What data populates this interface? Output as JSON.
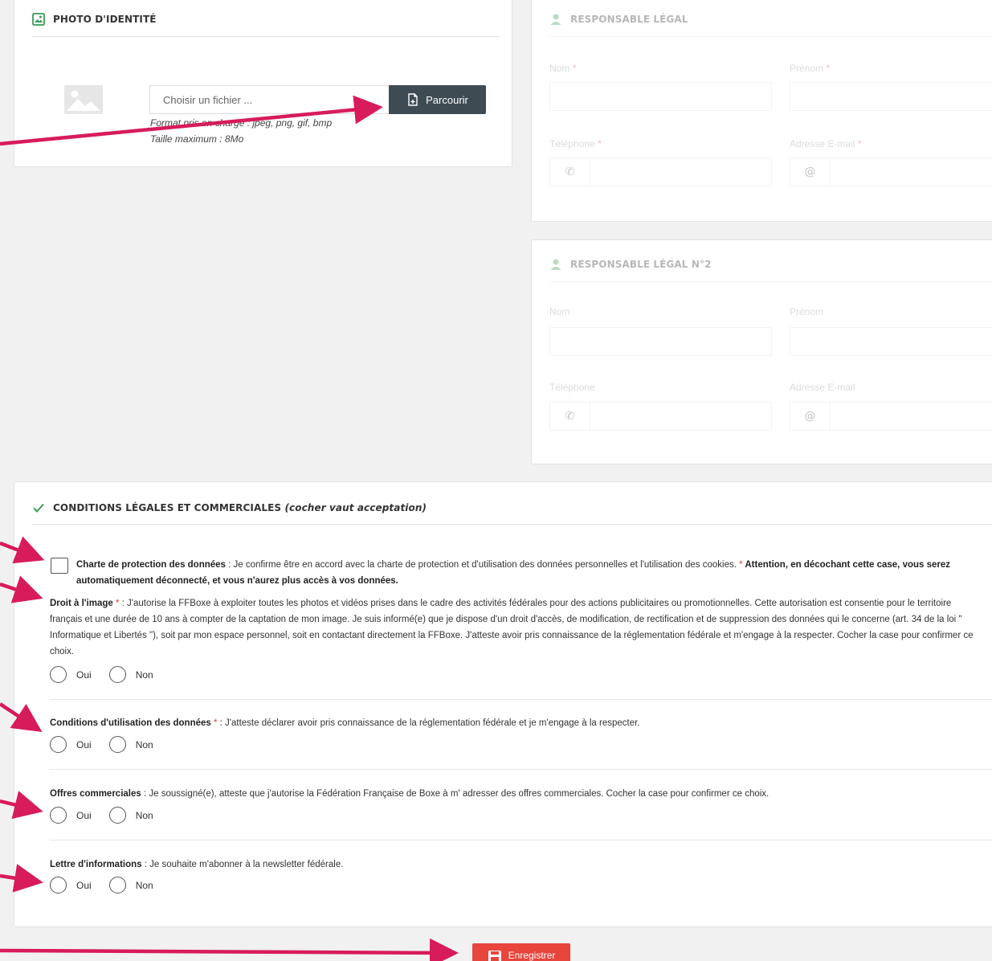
{
  "photo": {
    "title": "PHOTO D'IDENTITÉ",
    "file_placeholder": "Choisir un fichier ...",
    "browse_label": "Parcourir",
    "format_hint": "Format pris en charge : jpeg, png, gif, bmp",
    "size_hint": "Taille maximum : 8Mo"
  },
  "resp1": {
    "title": "RESPONSABLE LÉGAL",
    "nom": "Nom",
    "prenom": "Prénom",
    "telephone": "Téléphone",
    "email": "Adresse E-mail",
    "required_mark": "*"
  },
  "resp2": {
    "title": "RESPONSABLE LÉGAL N°2",
    "nom": "Nom",
    "prenom": "Prénom",
    "telephone": "Téléphone",
    "email": "Adresse E-mail"
  },
  "conditions": {
    "title": "CONDITIONS LÉGALES ET COMMERCIALES",
    "title_note": "(cocher vaut acceptation)",
    "charte": {
      "label": "Charte de protection des données",
      "text": " : Je confirme être en accord avec la charte de protection et d'utilisation des données personnelles et l'utilisation des cookies. ",
      "star": "*",
      "warning": " Attention, en décochant cette case, vous serez automatiquement déconnecté, et vous n'aurez plus accès à vos données."
    },
    "droit_image": {
      "label": "Droit à l'image",
      "star": " *",
      "text": " : J'autorise la FFBoxe à exploiter toutes les photos et vidéos prises dans le cadre des activités fédérales pour des actions publicitaires ou promotionnelles. Cette autorisation est consentie pour le territoire français et une durée de 10 ans à compter de la captation de mon image. Je suis informé(e) que je dispose d'un droit d'accès, de modification, de rectification et de suppression des données qui le concerne (art. 34 de la loi \" Informatique et Libertés \"), soit par mon espace personnel, soit en contactant directement la FFBoxe. J'atteste avoir pris connaissance de la réglementation fédérale et m'engage à la respecter. Cocher la case pour confirmer ce choix."
    },
    "conditions_utilisation": {
      "label": "Conditions d'utilisation des données",
      "star": " *",
      "text": " : J'atteste déclarer avoir pris connaissance de la réglementation fédérale et je m'engage à la respecter."
    },
    "offres": {
      "label": "Offres commerciales",
      "text": " : Je soussigné(e), atteste que j'autorise la Fédération Française de Boxe à m' adresser des offres commerciales. Cocher la case pour confirmer ce choix."
    },
    "lettre": {
      "label": "Lettre d'informations",
      "text": " : Je souhaite m'abonner à la newsletter fédérale."
    },
    "oui": "Oui",
    "non": "Non"
  },
  "save_label": "Enregistrer",
  "colors": {
    "arrow": "#d81b5a",
    "save": "#e8453c",
    "browse": "#3e4b53",
    "check": "#3a9a5a",
    "logo": "#1f4b8f"
  }
}
